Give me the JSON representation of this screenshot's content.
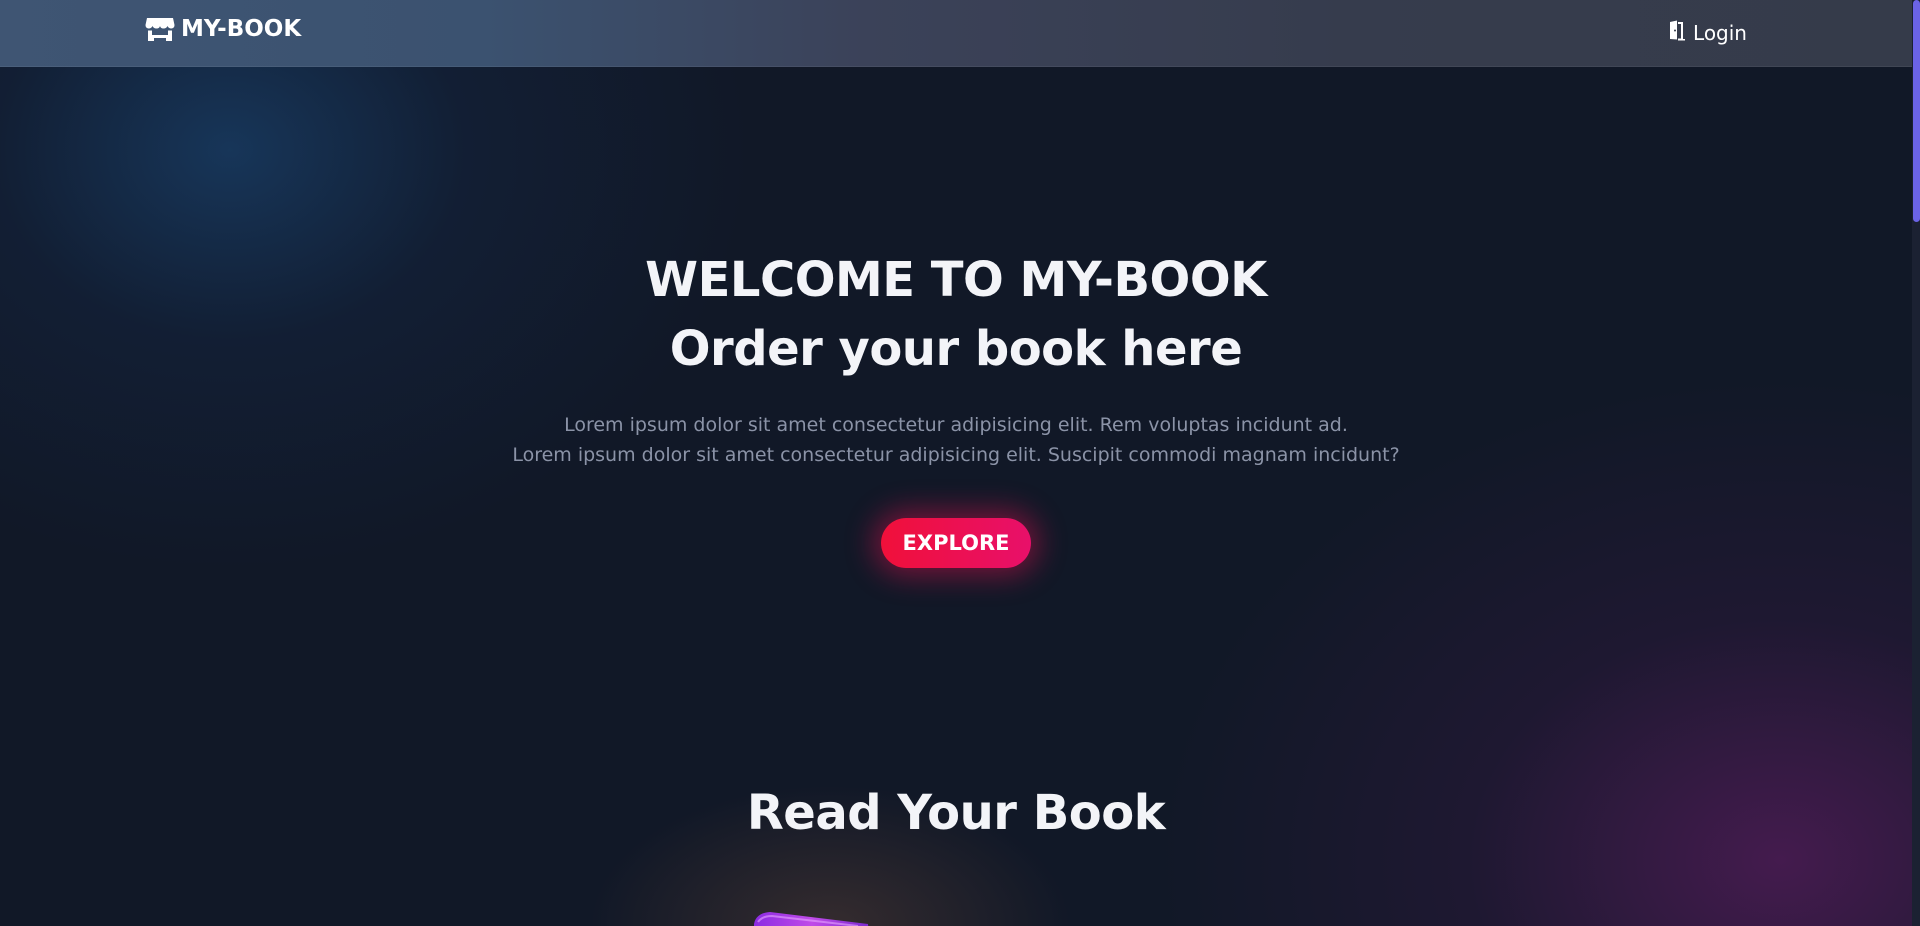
{
  "navbar": {
    "brand": {
      "icon": "store-icon",
      "label": "MY-BOOK"
    },
    "login": {
      "icon": "door-open-icon",
      "label": "Login"
    }
  },
  "hero": {
    "title": "WELCOME TO MY-BOOK",
    "subtitle": "Order your book here",
    "text_lines": [
      "Lorem ipsum dolor sit amet consectetur adipisicing elit. Rem voluptas incidunt ad.",
      "Lorem ipsum dolor sit amet consectetur adipisicing elit. Suscipit commodi magnam incidunt?"
    ],
    "cta_label": "EXPLORE"
  },
  "section": {
    "title": "Read Your Book"
  },
  "colors": {
    "accent": "#f0103a",
    "accent_end": "#e8106a",
    "scrollbar": "#6b63e6",
    "background": "#111827"
  }
}
